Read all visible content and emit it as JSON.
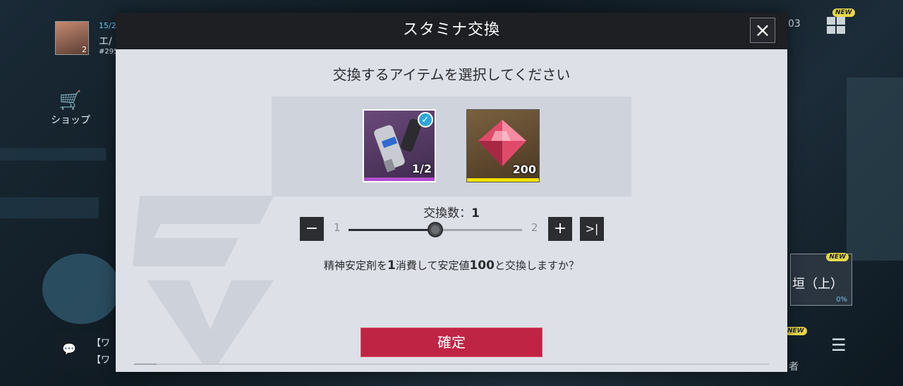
{
  "background": {
    "level": "2",
    "stamina": "15/2",
    "player_name": "エ/",
    "player_id": "#295",
    "shop_label": "ショップ",
    "new_badge": "NEW",
    "sliver_number": "03",
    "card_title": "垣（上）",
    "card_progress": "0%",
    "chat_line_1": "【ワ",
    "chat_line_2": "【ワ",
    "side_text": "者"
  },
  "modal": {
    "title": "スタミナ交換",
    "close_icon": "×",
    "prompt": "交換するアイテムを選択してください",
    "items": [
      {
        "icon": "stabilizer-injector-icon",
        "count": "1/2",
        "selected": true,
        "rarity_color": "#b04fd0"
      },
      {
        "icon": "red-crystal-icon",
        "count": "200",
        "selected": false,
        "rarity_color": "#f0e000"
      }
    ],
    "quantity_label": "交換数：",
    "quantity_value": "1",
    "range_min": "1",
    "range_max": "2",
    "slider_fraction": 0.5,
    "minus_label": "−",
    "plus_label": "+",
    "max_label": ">|",
    "confirm_text_1": "精神安定剤を",
    "confirm_num_1": "1",
    "confirm_text_2": "消費して安定値",
    "confirm_num_2": "100",
    "confirm_text_3": "と交換しますか？",
    "confirm_button": "確定"
  },
  "colors": {
    "accent": "#c02444",
    "header": "#1d1f23",
    "panel": "#dde0e7",
    "check": "#2ea7d6"
  }
}
